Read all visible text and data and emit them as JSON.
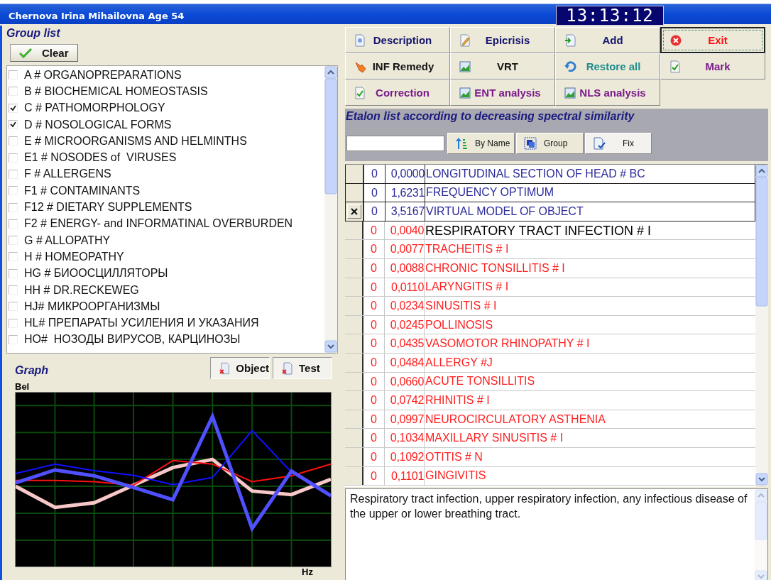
{
  "window": {
    "title": "Chernova Irina Mihailovna  Age  54",
    "clock": "13:13:12"
  },
  "group_list": {
    "title": "Group list",
    "clear_button": "Clear",
    "items": [
      {
        "label": "A # ORGANOPREPARATIONS",
        "checked": false
      },
      {
        "label": "B # BIOCHEMICAL HOMEOSTASIS",
        "checked": false
      },
      {
        "label": "C # PATHOMORPHOLOGY",
        "checked": true
      },
      {
        "label": "D # NOSOLOGICAL FORMS",
        "checked": true
      },
      {
        "label": "E # MICROORGANISMS AND HELMINTHS",
        "checked": false
      },
      {
        "label": "E1 # NOSODES of  VIRUSES",
        "checked": false
      },
      {
        "label": "F # ALLERGENS",
        "checked": false
      },
      {
        "label": "F1 # CONTAMINANTS",
        "checked": false
      },
      {
        "label": "F12 # DIETARY SUPPLEMENTS",
        "checked": false
      },
      {
        "label": "F2 # ENERGY- and INFORMATINAL OVERBURDEN",
        "checked": false
      },
      {
        "label": "G # ALLOPATHY",
        "checked": false
      },
      {
        "label": "H # HOMEOPATHY",
        "checked": false
      },
      {
        "label": "HG # БИООСЦИЛЛЯТОРЫ",
        "checked": false
      },
      {
        "label": "HH # DR.RECKEWEG",
        "checked": false
      },
      {
        "label": "HJ# МИКРООРГАНИЗМЫ",
        "checked": false
      },
      {
        "label": "HL# ПРЕПАРАТЫ УСИЛЕНИЯ И УКАЗАНИЯ",
        "checked": false
      },
      {
        "label": "HO#  НОЗОДЫ ВИРУСОВ, КАРЦИНОЗЫ",
        "checked": false
      }
    ]
  },
  "graph": {
    "title": "Graph",
    "y_axis_label": "Bel",
    "x_axis_label": "Hz",
    "buttons": [
      {
        "label": "Object"
      },
      {
        "label": "Test"
      }
    ]
  },
  "actions": [
    {
      "label": "Description",
      "color": "#14146e",
      "focused": false
    },
    {
      "label": "Epicrisis",
      "color": "#14146e",
      "focused": false
    },
    {
      "label": "Add",
      "color": "#14146e",
      "focused": false
    },
    {
      "label": "Exit",
      "color": "#ff1010",
      "focused": true
    },
    {
      "label": "INF Remedy",
      "color": "#141414",
      "focused": false
    },
    {
      "label": "VRT",
      "color": "#141414",
      "focused": false
    },
    {
      "label": "Restore all",
      "color": "#1e8c8c",
      "focused": false
    },
    {
      "label": "Mark",
      "color": "#7a1a8a",
      "focused": false
    },
    {
      "label": "Correction",
      "color": "#7a1a8a",
      "focused": false
    },
    {
      "label": "ENT analysis",
      "color": "#7a1a8a",
      "focused": false
    },
    {
      "label": "NLS analysis",
      "color": "#7a1a8a",
      "focused": false
    }
  ],
  "etalon": {
    "title": "Etalon list according to decreasing spectral similarity",
    "sort_buttons": [
      {
        "label": "By Name"
      },
      {
        "label": "Group"
      },
      {
        "label": "Fix"
      }
    ],
    "rows": [
      {
        "kind": "reference",
        "marked": false,
        "selected": false,
        "count": "0",
        "value": "0,0000",
        "name": "LONGITUDINAL SECTION OF HEAD # BC"
      },
      {
        "kind": "reference",
        "marked": false,
        "selected": false,
        "count": "0",
        "value": "1,6231",
        "name": "FREQUENCY OPTIMUM"
      },
      {
        "kind": "reference",
        "marked": true,
        "selected": false,
        "count": "0",
        "value": "3,5167",
        "name": "VIRTUAL MODEL OF OBJECT"
      },
      {
        "kind": "result",
        "marked": false,
        "selected": true,
        "count": "0",
        "value": "0,0040",
        "name": "RESPIRATORY TRACT INFECTION # I"
      },
      {
        "kind": "result",
        "marked": false,
        "selected": false,
        "count": "0",
        "value": "0,0077",
        "name": "TRACHEITIS # I"
      },
      {
        "kind": "result",
        "marked": false,
        "selected": false,
        "count": "0",
        "value": "0,0088",
        "name": "CHRONIC TONSILLITIS # I"
      },
      {
        "kind": "result",
        "marked": false,
        "selected": false,
        "count": "0",
        "value": "0,0110",
        "name": "LARYNGITIS # I"
      },
      {
        "kind": "result",
        "marked": false,
        "selected": false,
        "count": "0",
        "value": "0,0234",
        "name": "SINUSITIS # I"
      },
      {
        "kind": "result",
        "marked": false,
        "selected": false,
        "count": "0",
        "value": "0,0245",
        "name": "POLLINOSIS"
      },
      {
        "kind": "result",
        "marked": false,
        "selected": false,
        "count": "0",
        "value": "0,0435",
        "name": "VASOMOTOR RHINOPATHY # I"
      },
      {
        "kind": "result",
        "marked": false,
        "selected": false,
        "count": "0",
        "value": "0,0484",
        "name": "ALLERGY #J"
      },
      {
        "kind": "result",
        "marked": false,
        "selected": false,
        "count": "0",
        "value": "0,0660",
        "name": "ACUTE TONSILLITIS"
      },
      {
        "kind": "result",
        "marked": false,
        "selected": false,
        "count": "0",
        "value": "0,0742",
        "name": "RHINITIS # I"
      },
      {
        "kind": "result",
        "marked": false,
        "selected": false,
        "count": "0",
        "value": "0,0997",
        "name": "NEUROCIRCULATORY ASTHENIA"
      },
      {
        "kind": "result",
        "marked": false,
        "selected": false,
        "count": "0",
        "value": "0,1034",
        "name": "MAXILLARY SINUSITIS # I"
      },
      {
        "kind": "result",
        "marked": false,
        "selected": false,
        "count": "0",
        "value": "0,1092",
        "name": "OTITIS # N"
      },
      {
        "kind": "result",
        "marked": false,
        "selected": false,
        "count": "0",
        "value": "0,1101",
        "name": "GINGIVITIS"
      }
    ]
  },
  "description": {
    "text": "Respiratory tract infection, upper respiratory infection, any infectious disease of the upper or lower breathing tract."
  }
}
